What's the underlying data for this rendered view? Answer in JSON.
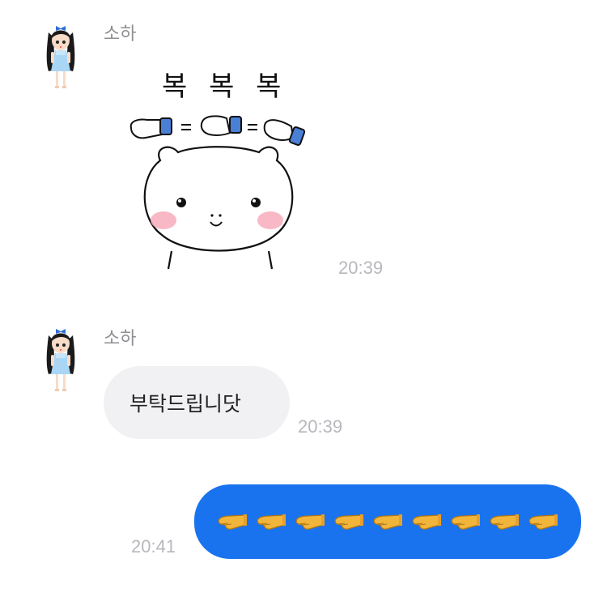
{
  "messages": {
    "m1": {
      "sender": "소하",
      "sticker_text": "복 복 복",
      "time": "20:39"
    },
    "m2": {
      "sender": "소하",
      "text": "부탁드립니닷",
      "time": "20:39"
    },
    "m3": {
      "emoji_count": 9,
      "emoji_name": "backhand-index-pointing-left",
      "time": "20:41"
    }
  },
  "colors": {
    "outgoing_bubble": "#1a73ee",
    "incoming_bubble": "#f1f1f4",
    "timestamp": "#b7b8bd",
    "sender_name": "#8e8e93"
  }
}
